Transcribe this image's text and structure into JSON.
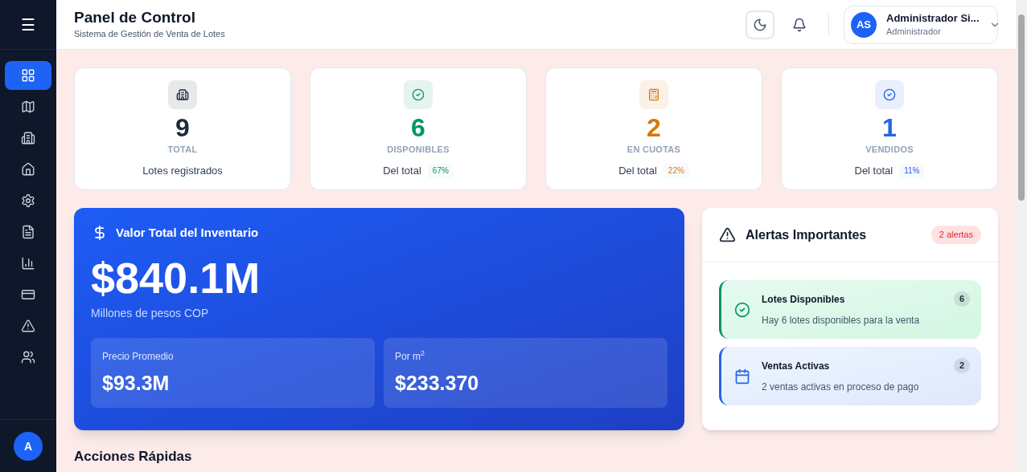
{
  "sidebar": {
    "menu_label": "☰",
    "items": [
      {
        "selected": true
      },
      {
        "selected": false
      },
      {
        "selected": false
      },
      {
        "selected": false
      },
      {
        "selected": false
      },
      {
        "selected": false
      },
      {
        "selected": false
      },
      {
        "selected": false
      },
      {
        "selected": false
      },
      {
        "selected": false
      }
    ],
    "avatar": "A"
  },
  "header": {
    "title": "Panel de Control",
    "subtitle": "Sistema de Gestión de Venta de Lotes",
    "user": {
      "initials": "AS",
      "name": "Administrador Si...",
      "role": "Administrador"
    }
  },
  "stats": [
    {
      "kind": "total",
      "value": "9",
      "label": "TOTAL",
      "caption": "Lotes registrados",
      "color": "#1e293b"
    },
    {
      "kind": "available",
      "value": "6",
      "label": "DISPONIBLES",
      "caption": "Del total",
      "percent": "67%",
      "color": "#059669"
    },
    {
      "kind": "installments",
      "value": "2",
      "label": "EN CUOTAS",
      "caption": "Del total",
      "percent": "22%",
      "color": "#d97706"
    },
    {
      "kind": "sold",
      "value": "1",
      "label": "VENDIDOS",
      "caption": "Del total",
      "percent": "11%",
      "color": "#2563eb"
    }
  ],
  "inventory": {
    "title": "Valor Total del Inventario",
    "value": "$840.1M",
    "unit": "Millones de pesos COP",
    "metrics": [
      {
        "label": "Precio Promedio",
        "value": "$93.3M"
      },
      {
        "label": "Por m$^{2}$",
        "value": "$233.370"
      }
    ]
  },
  "alerts": {
    "title": "Alertas Importantes",
    "badge": "2 alertas",
    "items": [
      {
        "kind": "success",
        "title": "Lotes Disponibles",
        "text": "Hay 6 lotes disponibles para la venta",
        "count": "6"
      },
      {
        "kind": "info",
        "title": "Ventas Activas",
        "text": "2 ventas activas en proceso de pago",
        "count": "2"
      }
    ]
  },
  "quick_actions": {
    "title": "Acciones Rápidas"
  }
}
